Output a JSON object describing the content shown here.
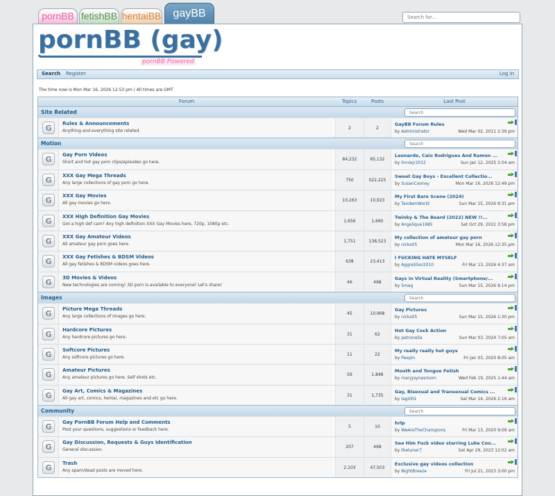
{
  "tabs": [
    "pornBB",
    "fetishBB",
    "hentaiBB",
    "gayBB"
  ],
  "top_search": {
    "placeholder": "Search for..."
  },
  "logo": {
    "title": "pornBB (gay)",
    "subtitle": "pornBB Powered"
  },
  "nav": {
    "search": "Search",
    "register": "Register",
    "login": "Log in"
  },
  "time_now": "The time now is Mon Mar 16, 2026 12:53 pm | All times are GMT",
  "table_head": {
    "forum": "Forum",
    "topics": "Topics",
    "posts": "Posts",
    "last_post": "Last Post"
  },
  "category_search_placeholder": "Search",
  "categories": [
    {
      "title": "Site Related",
      "forums": [
        {
          "name": "Rules & Announcements",
          "desc": "Anything and everything site related.",
          "topics": "2",
          "posts": "2",
          "last_title": "GayBB Forum Rules",
          "last_user": "Administrator",
          "last_date": "Wed Mar 02, 2011 2:39 pm"
        }
      ]
    },
    {
      "title": "Motion",
      "forums": [
        {
          "name": "Gay Porn Videos",
          "desc": "Short and hot gay porn clips/episodes go here.",
          "topics": "84,232",
          "posts": "85,132",
          "last_title": "Leonardo, Caio Rodrigues And Ramon ...",
          "last_user": "linniejr2012",
          "last_date": "Sun Jan 12, 2025 2:04 am"
        },
        {
          "name": "XXX Gay Mega Threads",
          "desc": "Any large collections of gay porn go here.",
          "topics": "750",
          "posts": "522,225",
          "last_title": "Sweet Gay Boys - Excellent Collectio...",
          "last_user": "SusanCooney",
          "last_date": "Mon Mar 16, 2026 12:49 pm"
        },
        {
          "name": "XXX Gay Movies",
          "desc": "All gay movies go here.",
          "topics": "10,263",
          "posts": "10,923",
          "last_title": "My First Bare Scene (2024)",
          "last_user": "TandemWorld",
          "last_date": "Sun Mar 15, 2026 9:31 pm"
        },
        {
          "name": "XXX High Definition Gay Movies",
          "desc": "Got a high def cam? Any high definition XXX Gay Movies here, 720p, 1080p etc.",
          "topics": "1,656",
          "posts": "1,660",
          "last_title": "Twinky & The Beard (2022) NEW !!...",
          "last_user": "Angelique1985",
          "last_date": "Sat Oct 29, 2022 3:58 pm"
        },
        {
          "name": "XXX Gay Amateur Videos",
          "desc": "All amateur gay porn goes here.",
          "topics": "1,751",
          "posts": "138,523",
          "last_title": "My collection of amateur gay porn",
          "last_user": "nicks05",
          "last_date": "Mon Mar 16, 2026 12:35 pm"
        },
        {
          "name": "XXX Gay Fetishes & BDSM Videos",
          "desc": "All gay fetishes & BDSM videos goes here.",
          "topics": "638",
          "posts": "23,413",
          "last_title": "I FUCKING HATE MYSELF",
          "last_user": "AggreSSor2010",
          "last_date": "Fri Mar 13, 2026 4:37 am"
        },
        {
          "name": "3D Movies & Videos",
          "desc": "New technologies are coming! 3D porn is available to everyone! Let's share!",
          "topics": "46",
          "posts": "498",
          "last_title": "Gays in Virtual Reality (Smartphone/...",
          "last_user": "Smag",
          "last_date": "Sun Mar 15, 2026 9:14 pm"
        }
      ]
    },
    {
      "title": "Images",
      "forums": [
        {
          "name": "Picture Mega Threads",
          "desc": "Any large collections of images go here.",
          "topics": "45",
          "posts": "10,968",
          "last_title": "Gay Pictures",
          "last_user": "nicks05",
          "last_date": "Sun Mar 15, 2026 1:30 pm"
        },
        {
          "name": "Hardcore Pictures",
          "desc": "Any hardcore pictures go here.",
          "topics": "31",
          "posts": "62",
          "last_title": "Hot Gay Cock Action",
          "last_user": "petronella",
          "last_date": "Sun Mar 03, 2024 7:05 am"
        },
        {
          "name": "Softcore Pictures",
          "desc": "Any softcore pictures go here.",
          "topics": "11",
          "posts": "22",
          "last_title": "My really really hot guys",
          "last_user": "Peepin",
          "last_date": "Fri Jan 03, 2020 8:05 am"
        },
        {
          "name": "Amateur Pictures",
          "desc": "Any amateur pictures go here. Self shots etc.",
          "topics": "59",
          "posts": "1,848",
          "last_title": "Mouth and Tongue Fetish",
          "last_user": "maryjaynesroom",
          "last_date": "Wed Feb 19, 2025 1:44 am"
        },
        {
          "name": "Gay Art, Comics & Magazines",
          "desc": "All gay art, comics, hentai, magazines and etc go here.",
          "topics": "31",
          "posts": "1,735",
          "last_title": "Gay, Bisexual and Transexual Comics ...",
          "last_user": "lagi001",
          "last_date": "Sat Mar 14, 2026 2:16 am"
        }
      ]
    },
    {
      "title": "Community",
      "forums": [
        {
          "name": "Gay PornBB Forum Help and Comments",
          "desc": "Post your questions, suggestions or feedback here.",
          "topics": "5",
          "posts": "10",
          "last_title": "hrlp",
          "last_user": "WeAreTheChampions",
          "last_date": "Fri Mar 13, 2020 9:09 am"
        },
        {
          "name": "Gay Discussion, Requests & Guys Identification",
          "desc": "General discussion.",
          "topics": "207",
          "posts": "468",
          "last_title": "See Him Fuck video starring Luke Coo...",
          "last_user": "thetuner7",
          "last_date": "Sat Apr 29, 2023 12:02 am"
        },
        {
          "name": "Trash",
          "desc": "Any spam/dead posts are moved here.",
          "topics": "2,103",
          "posts": "47,503",
          "last_title": "Exclusive gay videos collection",
          "last_user": "NightBreeze",
          "last_date": "Fri Jul 21, 2023 3:00 pm"
        }
      ]
    }
  ],
  "icons": {
    "forum": "forum-folder-icon",
    "goto": "goto-last-post-icon"
  },
  "colors": {
    "accent": "#3b6f9e",
    "link": "#1f5c8e",
    "pink": "#e76aa9"
  }
}
